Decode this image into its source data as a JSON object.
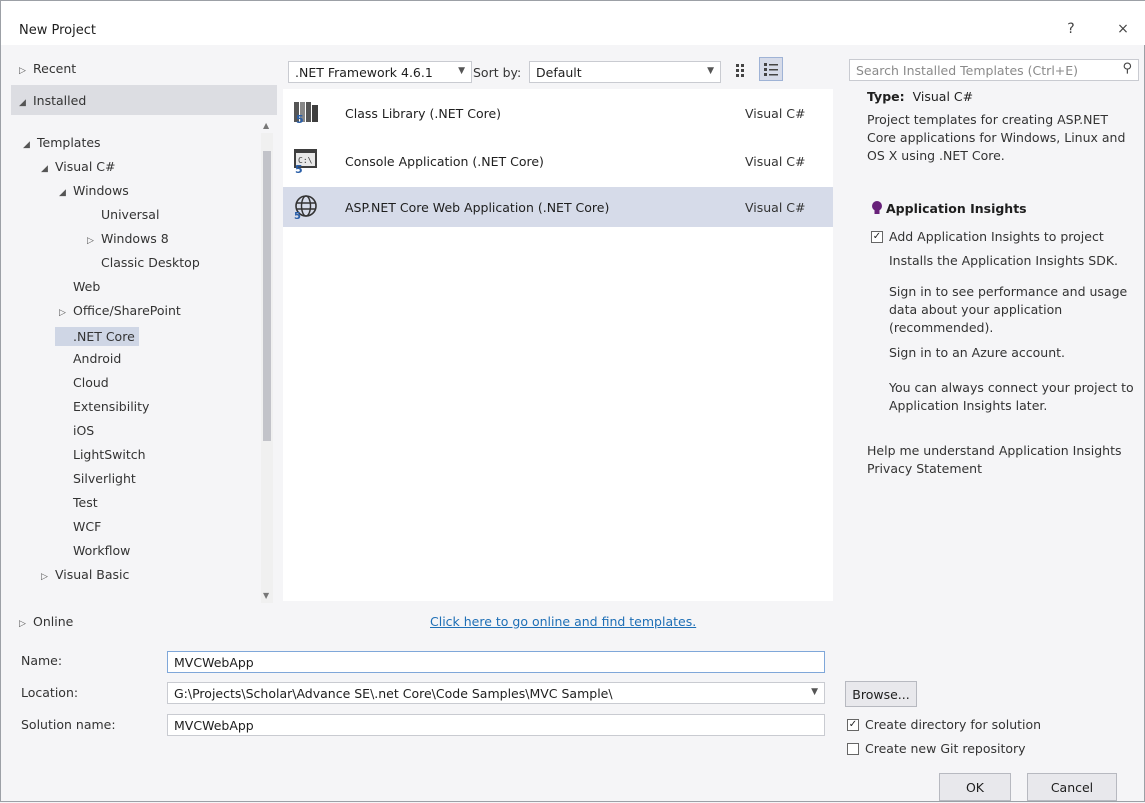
{
  "window": {
    "title": "New Project",
    "help_label": "?",
    "close_label": "×"
  },
  "nav": {
    "recent": "Recent",
    "installed": "Installed",
    "online": "Online",
    "tree": [
      {
        "label": "Templates",
        "arrow": "◢",
        "indent": 0
      },
      {
        "label": "Visual C#",
        "arrow": "◢",
        "indent": 1
      },
      {
        "label": "Windows",
        "arrow": "◢",
        "indent": 2
      },
      {
        "label": "Universal",
        "arrow": "",
        "indent": 3
      },
      {
        "label": "Windows 8",
        "arrow": "▷",
        "indent": 3
      },
      {
        "label": "Classic Desktop",
        "arrow": "",
        "indent": 3
      },
      {
        "label": "Web",
        "arrow": "",
        "indent": 2
      },
      {
        "label": "Office/SharePoint",
        "arrow": "▷",
        "indent": 2
      },
      {
        "label": ".NET Core",
        "arrow": "",
        "indent": 2,
        "selected": true
      },
      {
        "label": "Android",
        "arrow": "",
        "indent": 2
      },
      {
        "label": "Cloud",
        "arrow": "",
        "indent": 2
      },
      {
        "label": "Extensibility",
        "arrow": "",
        "indent": 2
      },
      {
        "label": "iOS",
        "arrow": "",
        "indent": 2
      },
      {
        "label": "LightSwitch",
        "arrow": "",
        "indent": 2
      },
      {
        "label": "Silverlight",
        "arrow": "",
        "indent": 2
      },
      {
        "label": "Test",
        "arrow": "",
        "indent": 2
      },
      {
        "label": "WCF",
        "arrow": "",
        "indent": 2
      },
      {
        "label": "Workflow",
        "arrow": "",
        "indent": 2
      },
      {
        "label": "Visual Basic",
        "arrow": "▷",
        "indent": 1
      }
    ]
  },
  "toolbar": {
    "framework": ".NET Framework 4.6.1",
    "sort_label": "Sort by:",
    "sort_value": "Default",
    "search_placeholder": "Search Installed Templates (Ctrl+E)"
  },
  "templates": [
    {
      "name": "Class Library (.NET Core)",
      "lang": "Visual C#",
      "icon": "class-library-icon"
    },
    {
      "name": "Console Application (.NET Core)",
      "lang": "Visual C#",
      "icon": "console-app-icon"
    },
    {
      "name": "ASP.NET Core Web Application (.NET Core)",
      "lang": "Visual C#",
      "icon": "web-app-icon",
      "selected": true
    }
  ],
  "online_link": "Click here to go online and find templates.",
  "details": {
    "type_label": "Type:",
    "type_value": "Visual C#",
    "description": "Project templates for creating ASP.NET Core applications for Windows, Linux and OS X using .NET Core.",
    "insights_title": "Application Insights",
    "insights_check_label": "Add Application Insights to project",
    "insights_sdk": "Installs the Application Insights SDK.",
    "signin_text": "Sign in to see performance and usage data about your application (recommended).",
    "signin_link": "Sign in to an Azure account.",
    "later_text": "You can always connect your project to Application Insights later.",
    "help_link": "Help me understand Application Insights",
    "privacy_link": "Privacy Statement"
  },
  "form": {
    "name_label": "Name:",
    "name_value": "MVCWebApp",
    "location_label": "Location:",
    "location_value": "G:\\Projects\\Scholar\\Advance SE\\.net Core\\Code Samples\\MVC Sample\\",
    "solution_label": "Solution name:",
    "solution_value": "MVCWebApp",
    "browse_label": "Browse...",
    "create_dir_label": "Create directory for solution",
    "create_git_label": "Create new Git repository",
    "ok_label": "OK",
    "cancel_label": "Cancel"
  },
  "colors": {
    "accent_link": "#1e6fb6",
    "selection": "#d6dbe9",
    "insights_icon": "#68217a"
  }
}
